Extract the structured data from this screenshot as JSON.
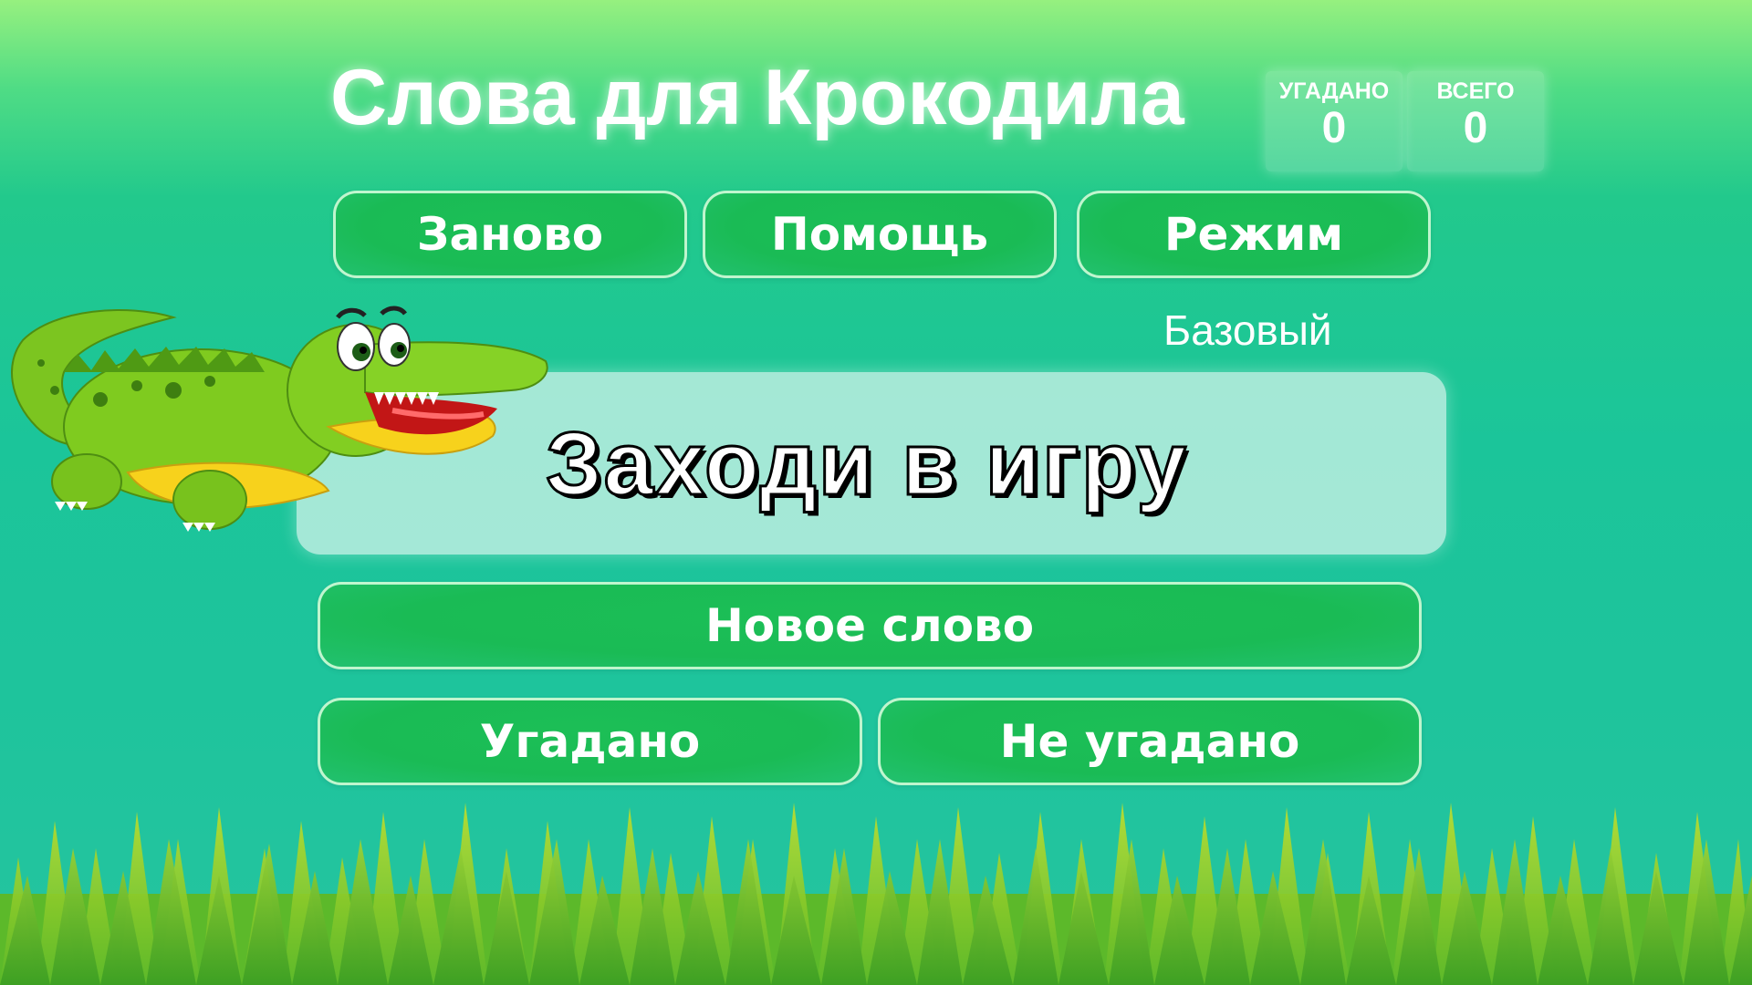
{
  "header": {
    "title": "Слова для Крокодила"
  },
  "score": {
    "guessed": {
      "label": "УГАДАНО",
      "value": "0"
    },
    "total": {
      "label": "ВСЕГО",
      "value": "0"
    }
  },
  "toolbar": {
    "restart_label": "Заново",
    "help_label": "Помощь",
    "mode_label": "Режим"
  },
  "mode": {
    "current": "Базовый"
  },
  "word": {
    "text": "Заходи в игру"
  },
  "actions": {
    "new_word_label": "Новое слово",
    "guessed_label": "Угадано",
    "not_guessed_label": "Не угадано"
  },
  "icons": {
    "mascot": "crocodile-icon",
    "ground": "grass-icon"
  },
  "colors": {
    "button": "#1cbf56",
    "background": "#1ec49c",
    "title": "#ffffff"
  }
}
